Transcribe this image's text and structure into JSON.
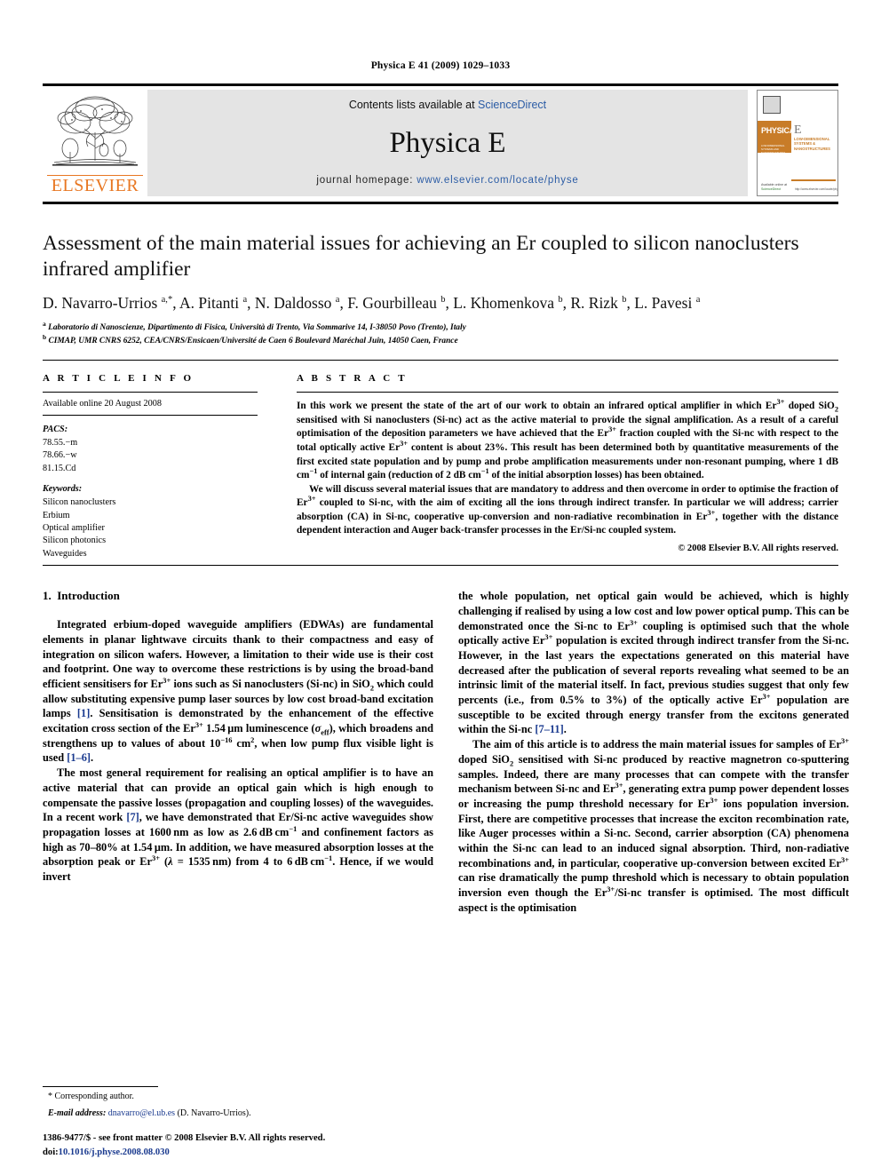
{
  "running_head": "Physica E 41 (2009) 1029–1033",
  "banner": {
    "contents_prefix": "Contents lists available at ",
    "contents_link": "ScienceDirect",
    "journal_title": "Physica E",
    "homepage_prefix": "journal homepage: ",
    "homepage_url": "www.elsevier.com/locate/physe",
    "publisher_logo_text": "ELSEVIER",
    "cover": {
      "wordmark": "PHYSICA",
      "letter": "E",
      "subtitle": "LOW-DIMENSIONAL SYSTEMS & NANOSTRUCTURES",
      "tagline": "LOW-DIMENSIONAL SYSTEMS AND NANOSTRUCTURES",
      "footer_left": "Available online at",
      "footer_sciencedirect": "ScienceDirect",
      "footer_right": "http://www.elsevier.com/locate/physe"
    }
  },
  "article": {
    "title": "Assessment of the main material issues for achieving an Er coupled to silicon nanoclusters infrared amplifier",
    "authors": "D. Navarro-Urrios a,*, A. Pitanti a, N. Daldosso a, F. Gourbilleau b, L. Khomenkova b, R. Rizk b, L. Pavesi a",
    "affiliations": [
      {
        "mark": "a",
        "text": "Laboratorio di Nanoscienze, Dipartimento di Fisica, Università di Trento, Via Sommarive 14, I-38050 Povo (Trento), Italy"
      },
      {
        "mark": "b",
        "text": "CIMAP, UMR CNRS 6252, CEA/CNRS/Ensicaen/Université de Caen 6 Boulevard Maréchal Juin, 14050 Caen, France"
      }
    ]
  },
  "article_info": {
    "heading": "A R T I C L E   I N F O",
    "available_online": "Available online 20 August 2008",
    "pacs_label": "PACS:",
    "pacs": [
      "78.55.−m",
      "78.66.−w",
      "81.15.Cd"
    ],
    "keywords_label": "Keywords:",
    "keywords": [
      "Silicon nanoclusters",
      "Erbium",
      "Optical amplifier",
      "Silicon photonics",
      "Waveguides"
    ]
  },
  "abstract": {
    "heading": "A B S T R A C T",
    "paragraphs": [
      "In this work we present the state of the art of our work to obtain an infrared optical amplifier in which Er3+ doped SiO2 sensitised with Si nanoclusters (Si-nc) act as the active material to provide the signal amplification. As a result of a careful optimisation of the deposition parameters we have achieved that the Er3+ fraction coupled with the Si-nc with respect to the total optically active Er3+ content is about 23%. This result has been determined both by quantitative measurements of the first excited state population and by pump and probe amplification measurements under non-resonant pumping, where 1 dB cm−1 of internal gain (reduction of 2 dB cm−1 of the initial absorption losses) has been obtained.",
      "We will discuss several material issues that are mandatory to address and then overcome in order to optimise the fraction of Er3+ coupled to Si-nc, with the aim of exciting all the ions through indirect transfer. In particular we will address; carrier absorption (CA) in Si-nc, cooperative up-conversion and non-radiative recombination in Er3+, together with the distance dependent interaction and Auger back-transfer processes in the Er/Si-nc coupled system."
    ],
    "copyright": "© 2008 Elsevier B.V. All rights reserved."
  },
  "body": {
    "section_number": "1.",
    "section_title": "Introduction",
    "left_column_paragraphs": [
      "Integrated erbium-doped waveguide amplifiers (EDWAs) are fundamental elements in planar lightwave circuits thank to their compactness and easy of integration on silicon wafers. However, a limitation to their wide use is their cost and footprint. One way to overcome these restrictions is by using the broad-band efficient sensitisers for Er3+ ions such as Si nanoclusters (Si-nc) in SiO2 which could allow substituting expensive pump laser sources by low cost broad-band excitation lamps [1]. Sensitisation is demonstrated by the enhancement of the effective excitation cross section of the Er3+ 1.54 μm luminescence (σeff), which broadens and strengthens up to values of about 10−16 cm2, when low pump flux visible light is used [1–6].",
      "The most general requirement for realising an optical amplifier is to have an active material that can provide an optical gain which is high enough to compensate the passive losses (propagation and coupling losses) of the waveguides. In a recent work [7], we have demonstrated that Er/Si-nc active waveguides show propagation losses at 1600 nm as low as 2.6 dB cm−1 and confinement factors as high as 70–80% at 1.54 μm. In addition, we have measured absorption losses at the absorption peak or Er3+ (λ = 1535 nm) from 4 to 6 dB cm−1. Hence, if we would invert"
    ],
    "right_column_paragraphs": [
      "the whole population, net optical gain would be achieved, which is highly challenging if realised by using a low cost and low power optical pump. This can be demonstrated once the Si-nc to Er3+ coupling is optimised such that the whole optically active Er3+ population is excited through indirect transfer from the Si-nc. However, in the last years the expectations generated on this material have decreased after the publication of several reports revealing what seemed to be an intrinsic limit of the material itself. In fact, previous studies suggest that only few percents (i.e., from 0.5% to 3%) of the optically active Er3+ population are susceptible to be excited through energy transfer from the excitons generated within the Si-nc [7–11].",
      "The aim of this article is to address the main material issues for samples of Er3+ doped SiO2 sensitised with Si-nc produced by reactive magnetron co-sputtering samples. Indeed, there are many processes that can compete with the transfer mechanism between Si-nc and Er3+, generating extra pump power dependent losses or increasing the pump threshold necessary for Er3+ ions population inversion. First, there are competitive processes that increase the exciton recombination rate, like Auger processes within a Si-nc. Second, carrier absorption (CA) phenomena within the Si-nc can lead to an induced signal absorption. Third, non-radiative recombinations and, in particular, cooperative up-conversion between excited Er3+ can rise dramatically the pump threshold which is necessary to obtain population inversion even though the Er3+/Si-nc transfer is optimised. The most difficult aspect is the optimisation"
    ]
  },
  "footnote": {
    "corresponding_author": "* Corresponding author.",
    "email_label": "E-mail address:",
    "email": "dnavarro@el.ub.es",
    "email_owner": "(D. Navarro-Urrios)."
  },
  "colophon": {
    "issn_line": "1386-9477/$ - see front matter © 2008 Elsevier B.V. All rights reserved.",
    "doi_label": "doi:",
    "doi_value": "10.1016/j.physe.2008.08.030"
  },
  "colors": {
    "link_blue": "#1a3a8f",
    "sciencedirect_blue": "#2b5ca5",
    "elsevier_orange": "#E87722",
    "banner_gray": "#e4e4e4"
  }
}
